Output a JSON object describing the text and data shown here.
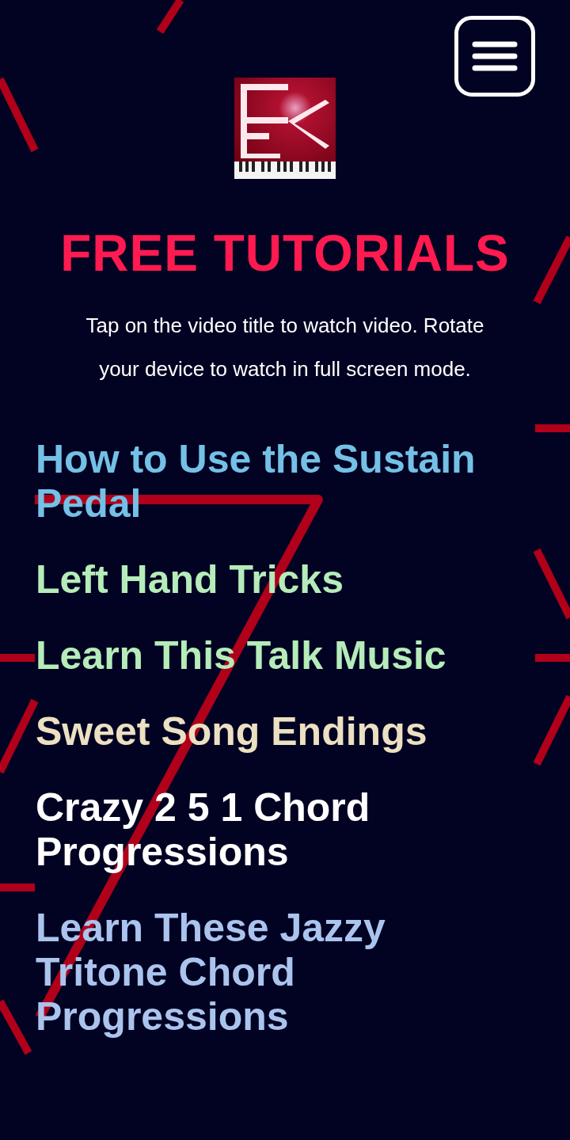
{
  "title": "FREE TUTORIALS",
  "instructions": "Tap on the video title to watch video. Rotate your device to watch in full screen mode.",
  "tutorials": [
    {
      "title": "How to Use the Sustain Pedal",
      "color": "#74c0e6"
    },
    {
      "title": "Left Hand Tricks",
      "color": "#b5ecb9"
    },
    {
      "title": "Learn This Talk Music",
      "color": "#b5ecb9"
    },
    {
      "title": "Sweet Song Endings",
      "color": "#ece0c2"
    },
    {
      "title": "Crazy 2 5 1 Chord Progressions",
      "color": "#ffffff"
    },
    {
      "title": "Learn These Jazzy Tritone Chord Progressions",
      "color": "#aac4ee"
    }
  ]
}
